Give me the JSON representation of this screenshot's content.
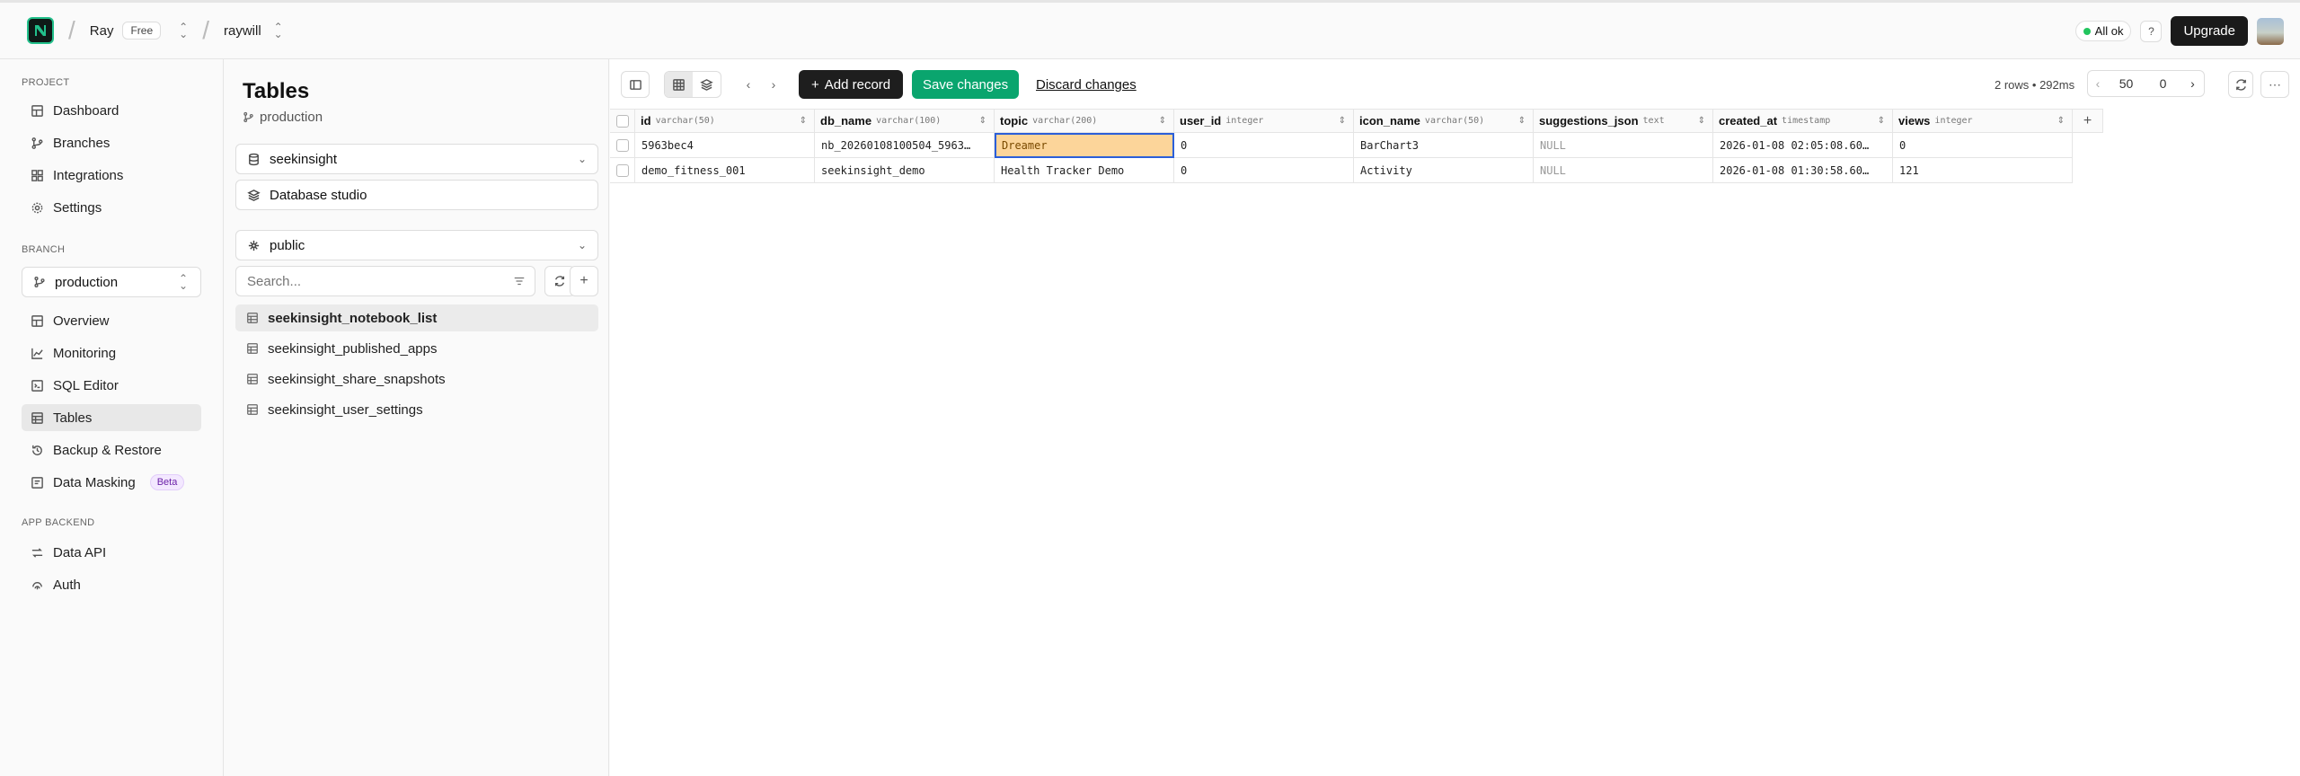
{
  "topbar": {
    "project": "Ray",
    "plan": "Free",
    "org": "raywill",
    "status": "All ok",
    "help_label": "?",
    "upgrade": "Upgrade"
  },
  "sidebar": {
    "project_label": "PROJECT",
    "project_items": [
      "Dashboard",
      "Branches",
      "Integrations",
      "Settings"
    ],
    "branch_label": "BRANCH",
    "branch_value": "production",
    "branch_items": [
      "Overview",
      "Monitoring",
      "SQL Editor",
      "Tables",
      "Backup & Restore",
      "Data Masking"
    ],
    "beta_badge": "Beta",
    "backend_label": "APP BACKEND",
    "backend_items": [
      "Data API",
      "Auth"
    ]
  },
  "tables_panel": {
    "title": "Tables",
    "branch": "production",
    "database": "seekinsight",
    "studio": "Database studio",
    "schema": "public",
    "search_placeholder": "Search...",
    "tables": [
      "seekinsight_notebook_list",
      "seekinsight_published_apps",
      "seekinsight_share_snapshots",
      "seekinsight_user_settings"
    ]
  },
  "toolbar": {
    "add_record": "Add record",
    "save_changes": "Save changes",
    "discard_changes": "Discard changes",
    "rows_info": "2 rows • 292ms",
    "page_size": "50",
    "offset": "0"
  },
  "grid": {
    "columns": [
      {
        "name": "id",
        "type": "varchar(50)"
      },
      {
        "name": "db_name",
        "type": "varchar(100)"
      },
      {
        "name": "topic",
        "type": "varchar(200)"
      },
      {
        "name": "user_id",
        "type": "integer"
      },
      {
        "name": "icon_name",
        "type": "varchar(50)"
      },
      {
        "name": "suggestions_json",
        "type": "text"
      },
      {
        "name": "created_at",
        "type": "timestamp"
      },
      {
        "name": "views",
        "type": "integer"
      }
    ],
    "rows": [
      [
        "5963bec4",
        "nb_20260108100504_5963…",
        "Dreamer",
        "0",
        "BarChart3",
        "NULL",
        "2026-01-08 02:05:08.60…",
        "0"
      ],
      [
        "demo_fitness_001",
        "seekinsight_demo",
        "Health Tracker Demo",
        "0",
        "Activity",
        "NULL",
        "2026-01-08 01:30:58.60…",
        "121"
      ]
    ]
  }
}
